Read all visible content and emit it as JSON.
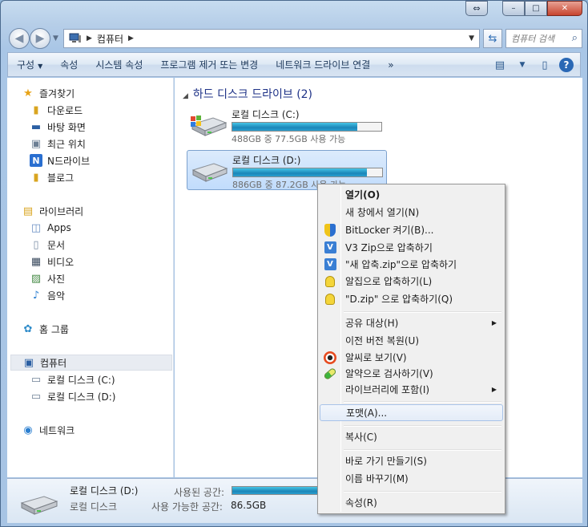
{
  "window": {
    "caption_buttons": {
      "minimize": "–",
      "maximize": "□",
      "close": "✕"
    }
  },
  "address": {
    "path": [
      "컴퓨터"
    ],
    "search_placeholder": "컴퓨터 검색"
  },
  "commandbar": {
    "items": [
      "구성",
      "속성",
      "시스템 속성",
      "프로그램 제거 또는 변경",
      "네트워크 드라이브 연결",
      "»"
    ]
  },
  "nav": {
    "favorites": {
      "label": "즐겨찾기",
      "items": [
        "다운로드",
        "바탕 화면",
        "최근 위치",
        "N드라이브",
        "블로그"
      ]
    },
    "libraries": {
      "label": "라이브러리",
      "items": [
        "Apps",
        "문서",
        "비디오",
        "사진",
        "음악"
      ]
    },
    "homegroup": {
      "label": "홈 그룹"
    },
    "computer": {
      "label": "컴퓨터",
      "items": [
        "로컬 디스크 (C:)",
        "로컬 디스크 (D:)"
      ]
    },
    "network": {
      "label": "네트워크"
    }
  },
  "content": {
    "group_title": "하드 디스크 드라이브 (2)",
    "drives": [
      {
        "name": "로컬 디스크 (C:)",
        "info": "488GB 중 77.5GB 사용 가능",
        "used_fraction": 0.84
      },
      {
        "name": "로컬 디스크 (D:)",
        "info": "886GB 중 87.2GB 사용 가능",
        "used_fraction": 0.9
      }
    ]
  },
  "details": {
    "name": "로컬 디스크 (D:)",
    "type": "로컬 디스크",
    "used_label": "사용된 공간:",
    "free_label": "사용 가능한 공간:",
    "free_value": "86.5GB"
  },
  "context_menu": {
    "items": [
      {
        "label": "열기(O)"
      },
      {
        "label": "새 창에서 열기(N)"
      },
      {
        "label": "BitLocker 켜기(B)..."
      },
      {
        "label": "V3 Zip으로 압축하기"
      },
      {
        "label": "\"새 압축.zip\"으로 압축하기"
      },
      {
        "label": "알집으로 압축하기(L)"
      },
      {
        "label": "\"D.zip\" 으로 압축하기(Q)"
      },
      {
        "label": "공유 대상(H)"
      },
      {
        "label": "이전 버전 복원(U)"
      },
      {
        "label": "알씨로 보기(V)"
      },
      {
        "label": "알약으로 검사하기(V)"
      },
      {
        "label": "라이브러리에 포함(I)"
      },
      {
        "label": "포맷(A)..."
      },
      {
        "label": "복사(C)"
      },
      {
        "label": "바로 가기 만들기(S)"
      },
      {
        "label": "이름 바꾸기(M)"
      },
      {
        "label": "속성(R)"
      }
    ]
  }
}
